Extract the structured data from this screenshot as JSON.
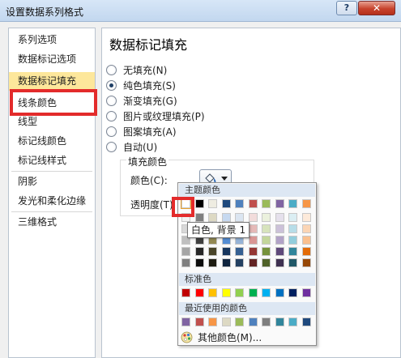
{
  "window": {
    "title": "设置数据系列格式",
    "help_label": "?",
    "close_label": "✕"
  },
  "sidebar": {
    "items": [
      {
        "label": "系列选项"
      },
      {
        "label": "数据标记选项"
      },
      {
        "label": "数据标记填充",
        "selected": true
      },
      {
        "label": "线条颜色"
      },
      {
        "label": "线型"
      },
      {
        "label": "标记线颜色"
      },
      {
        "label": "标记线样式"
      },
      {
        "label": "阴影"
      },
      {
        "label": "发光和柔化边缘"
      },
      {
        "label": "三维格式"
      }
    ]
  },
  "content": {
    "title": "数据标记填充",
    "fill_options": [
      {
        "label": "无填充(N)",
        "checked": false
      },
      {
        "label": "纯色填充(S)",
        "checked": true
      },
      {
        "label": "渐变填充(G)",
        "checked": false
      },
      {
        "label": "图片或纹理填充(P)",
        "checked": false
      },
      {
        "label": "图案填充(A)",
        "checked": false
      },
      {
        "label": "自动(U)",
        "checked": false
      }
    ],
    "fill_color_group": {
      "title": "填充颜色",
      "color_label": "颜色(C):",
      "transparency_label": "透明度(T)"
    }
  },
  "palette": {
    "theme_header": "主题颜色",
    "theme_top_row": [
      "#ffffff",
      "#000000",
      "#eeece1",
      "#1f497d",
      "#4f81bd",
      "#c0504d",
      "#9bbb59",
      "#8064a2",
      "#4bacc6",
      "#f79646"
    ],
    "theme_shades": [
      [
        "#f2f2f2",
        "#7f7f7f",
        "#ddd9c3",
        "#c6d9f0",
        "#dbe5f1",
        "#f2dcdb",
        "#ebf1dd",
        "#e5e0ec",
        "#dbeef3",
        "#fdeada"
      ],
      [
        "#d8d8d8",
        "#595959",
        "#c4bd97",
        "#8db3e2",
        "#b8cce4",
        "#e5b9b7",
        "#d7e3bc",
        "#ccc1d9",
        "#b7dde8",
        "#fbd5b5"
      ],
      [
        "#bfbfbf",
        "#3f3f3f",
        "#938953",
        "#548dd4",
        "#95b3d7",
        "#d99694",
        "#c3d69b",
        "#b2a2c7",
        "#92cddc",
        "#fac08f"
      ],
      [
        "#a5a5a5",
        "#262626",
        "#494429",
        "#17365d",
        "#366092",
        "#953734",
        "#76923c",
        "#5f497a",
        "#31859b",
        "#e36c09"
      ],
      [
        "#7f7f7f",
        "#0c0c0c",
        "#1d1b10",
        "#0f243e",
        "#244061",
        "#632423",
        "#4f6128",
        "#3f3151",
        "#205867",
        "#974806"
      ]
    ],
    "standard_header": "标准色",
    "standard_colors": [
      "#c00000",
      "#ff0000",
      "#ffc000",
      "#ffff00",
      "#92d050",
      "#00b050",
      "#00b0f0",
      "#0070c0",
      "#002060",
      "#7030a0"
    ],
    "recent_header": "最近使用的颜色",
    "recent_colors": [
      "#8064a2",
      "#c0504d",
      "#f79646",
      "#ddd9c3",
      "#9bbb59",
      "#4f81bd",
      "#7f7f7f",
      "#31859b",
      "#4bacc6",
      "#1f497d"
    ],
    "more_colors_label": "其他颜色(M)..."
  },
  "tooltip": {
    "text": "白色, 背景 1"
  },
  "accent": {
    "highlight_red": "#e32b2b",
    "selected_item_bg": "#fde79b"
  }
}
